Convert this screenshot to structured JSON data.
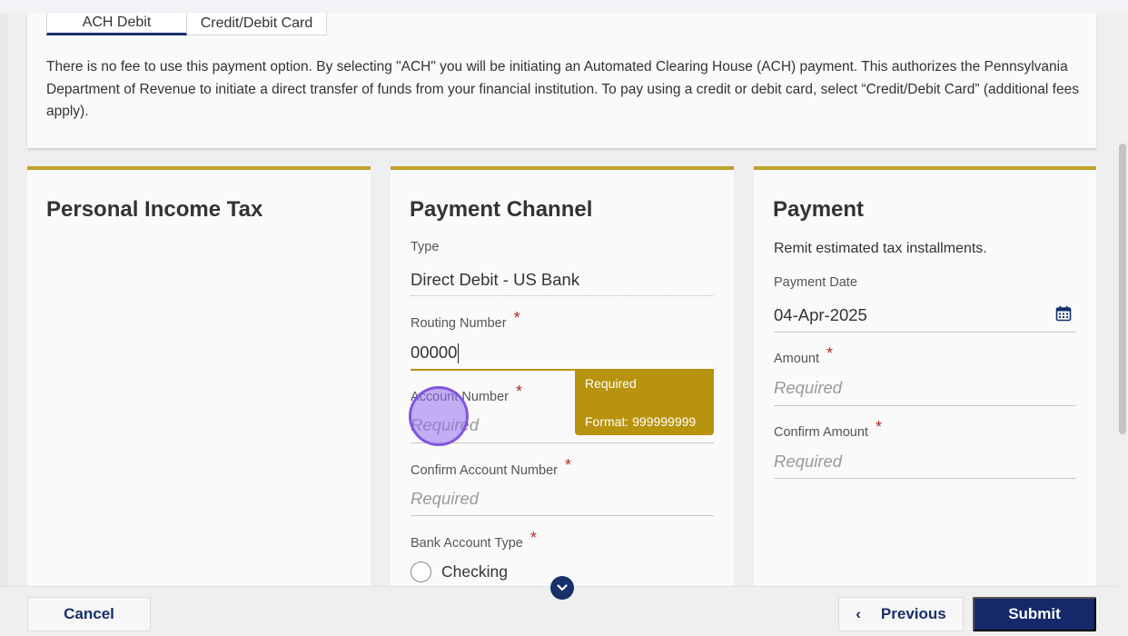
{
  "tabs": {
    "ach": "ACH Debit",
    "card": "Credit/Debit Card"
  },
  "info_text": "There is no fee to use this payment option. By selecting \"ACH\" you will be initiating an Automated Clearing House (ACH) payment. This authorizes the Pennsylvania Department of Revenue to initiate a direct transfer of funds from your financial institution. To pay using a credit or debit card, select “Credit/Debit Card” (additional fees apply).",
  "left_panel": {
    "title": "Personal Income Tax"
  },
  "payment_channel": {
    "title": "Payment Channel",
    "type_label": "Type",
    "type_value": "Direct Debit - US Bank",
    "routing_label": "Routing Number",
    "routing_value": "00000",
    "account_label": "Account Number",
    "account_placeholder": "Required",
    "confirm_account_label": "Confirm Account Number",
    "confirm_account_placeholder": "Required",
    "bank_type_label": "Bank Account Type",
    "checking_label": "Checking",
    "required_mark": "*"
  },
  "tooltip": {
    "line1": "Required",
    "line2": "Format: 999999999"
  },
  "payment": {
    "title": "Payment",
    "description": "Remit estimated tax installments.",
    "date_label": "Payment Date",
    "date_value": "04-Apr-2025",
    "amount_label": "Amount",
    "amount_placeholder": "Required",
    "confirm_amount_label": "Confirm Amount",
    "confirm_amount_placeholder": "Required",
    "required_mark": "*"
  },
  "footer": {
    "cancel": "Cancel",
    "previous": "Previous",
    "previous_icon": "‹",
    "submit": "Submit"
  },
  "colors": {
    "accent_gold": "#c0a12b",
    "navy": "#15296a",
    "tooltip_bg": "#b8930e",
    "required_red": "#b52a2a"
  },
  "icons": [
    "calendar-icon",
    "chevron-left-icon",
    "chevron-down-icon"
  ]
}
